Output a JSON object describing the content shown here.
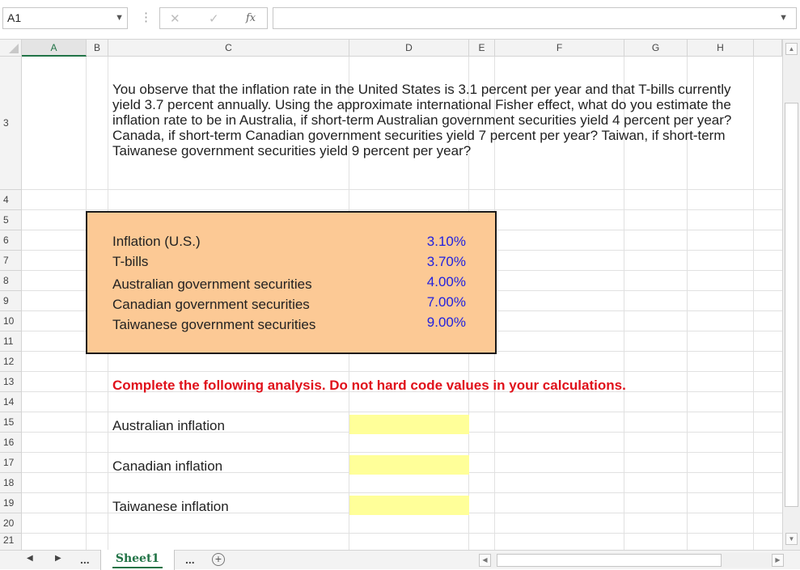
{
  "formula_bar": {
    "name_box": "A1",
    "formula": "",
    "cancel_glyph": "✕",
    "enter_glyph": "✓",
    "fx_label": "fx",
    "dots": "⋮"
  },
  "columns": [
    "A",
    "B",
    "C",
    "D",
    "E",
    "F",
    "G",
    "H"
  ],
  "rows": [
    "3",
    "4",
    "5",
    "6",
    "7",
    "8",
    "9",
    "10",
    "11",
    "12",
    "13",
    "14",
    "15",
    "16",
    "17",
    "18",
    "19",
    "20",
    "21"
  ],
  "question": "You observe that the inflation rate in the United States is 3.1 percent per year and that T-bills currently yield 3.7 percent annually. Using the approximate international Fisher effect, what do you estimate the inflation rate to be in Australia, if short-term Australian government securities yield 4 percent per year? Canada, if short-term Canadian government securities yield 7 percent per year? Taiwan, if short-term Taiwanese government securities yield 9 percent per year?",
  "inputs": [
    {
      "label": "Inflation (U.S.)",
      "value": "3.10%"
    },
    {
      "label": "T-bills",
      "value": "3.70%"
    },
    {
      "label": "Australian government securities",
      "value": "4.00%"
    },
    {
      "label": "Canadian government securities",
      "value": "7.00%"
    },
    {
      "label": "Taiwanese government securities",
      "value": "9.00%"
    }
  ],
  "instruction": "Complete the following analysis. Do not hard code values in your calculations.",
  "answers": [
    {
      "label": "Australian inflation",
      "value": ""
    },
    {
      "label": "Canadian inflation",
      "value": ""
    },
    {
      "label": "Taiwanese inflation",
      "value": ""
    }
  ],
  "sheet_bar": {
    "tab": "Sheet1",
    "ellipsis": "...",
    "add_glyph": "+",
    "prev_glyph": "◀",
    "next_glyph": "▶"
  },
  "colors": {
    "accent": "#217346",
    "input_box_fill": "#fcc995",
    "value_blue": "#1f1fe0",
    "instruction_red": "#e0101a",
    "answer_fill": "#ffff99"
  }
}
